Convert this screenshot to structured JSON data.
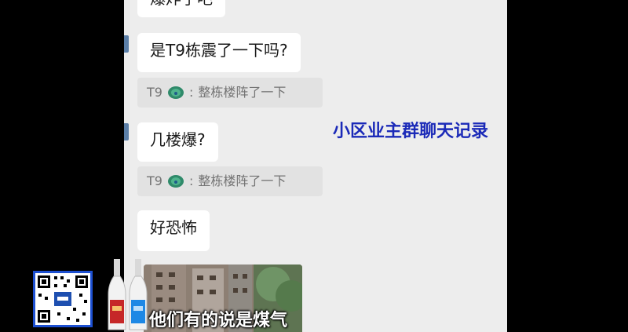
{
  "chat": {
    "top_bubble_partial": "爆炸了吧",
    "messages": [
      {
        "text": "是T9栋震了一下吗?"
      },
      {
        "quote_sender": "T9",
        "quote_text": "整栋楼阵了一下"
      },
      {
        "text": "几楼爆?"
      },
      {
        "quote_sender": "T9",
        "quote_text": "整栋楼阵了一下"
      },
      {
        "text": "好恐怖"
      }
    ]
  },
  "overlay": {
    "caption": "小区业主群聊天记录",
    "subtitle": "他们有的说是煤气"
  },
  "colors": {
    "chat_bg": "#ededed",
    "caption": "#1b2ab8",
    "qr_border": "#1c4fd1"
  }
}
